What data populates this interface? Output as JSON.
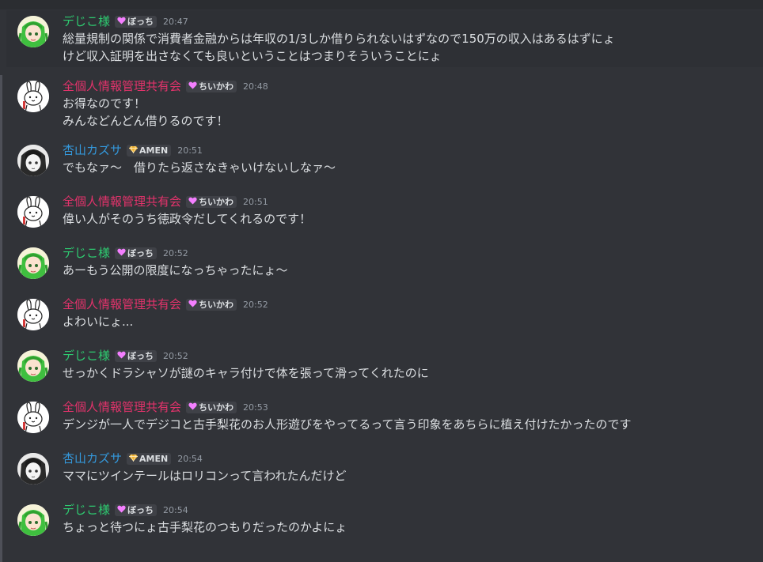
{
  "colors": {
    "background": "#313338",
    "name_dejiko": "#2ecc71",
    "name_zenko": "#e2336b",
    "name_kazusa": "#3498db",
    "timestamp": "#949ba4",
    "role_badge_bg": "#3f4147",
    "heart_icon": "#f47fff",
    "gem_icon": "#f0b232"
  },
  "messages": [
    {
      "author": "デじこ様",
      "author_class": "dejiko",
      "role_icon": "heart-icon",
      "role": "ぼっち",
      "time": "20:47",
      "lines": [
        "総量規制の関係で消費者金融からは年収の1/3しか借りられないはずなので150万の収入はあるはずにょ",
        "けど収入証明を出さなくても良いということはつまりそういうことにょ"
      ]
    },
    {
      "author": "全個人情報管理共有会",
      "author_class": "zenko",
      "role_icon": "heart-icon",
      "role": "ちいかわ",
      "time": "20:48",
      "lines": [
        "お得なのです！",
        "みんなどんどん借りるのです！"
      ]
    },
    {
      "author": "杏山カズサ",
      "author_class": "kazusa",
      "role_icon": "gem-icon",
      "role": "AMEN",
      "time": "20:51",
      "lines": [
        "でもなァ～　借りたら返さなきゃいけないしなァ～"
      ]
    },
    {
      "author": "全個人情報管理共有会",
      "author_class": "zenko",
      "role_icon": "heart-icon",
      "role": "ちいかわ",
      "time": "20:51",
      "lines": [
        "偉い人がそのうち徳政令だしてくれるのです！"
      ]
    },
    {
      "author": "デじこ様",
      "author_class": "dejiko",
      "role_icon": "heart-icon",
      "role": "ぼっち",
      "time": "20:52",
      "lines": [
        "あーもう公開の限度になっちゃったにょ～"
      ]
    },
    {
      "author": "全個人情報管理共有会",
      "author_class": "zenko",
      "role_icon": "heart-icon",
      "role": "ちいかわ",
      "time": "20:52",
      "lines": [
        "よわいにょ..."
      ]
    },
    {
      "author": "デじこ様",
      "author_class": "dejiko",
      "role_icon": "heart-icon",
      "role": "ぼっち",
      "time": "20:52",
      "lines": [
        "せっかくドラシャソが謎のキャラ付けで体を張って滑ってくれたのに"
      ]
    },
    {
      "author": "全個人情報管理共有会",
      "author_class": "zenko",
      "role_icon": "heart-icon",
      "role": "ちいかわ",
      "time": "20:53",
      "lines": [
        "デンジが一人でデジコと古手梨花のお人形遊びをやってるって言う印象をあちらに植え付けたかったのです"
      ]
    },
    {
      "author": "杏山カズサ",
      "author_class": "kazusa",
      "role_icon": "gem-icon",
      "role": "AMEN",
      "time": "20:54",
      "lines": [
        "ママにツインテールはロリコンって言われたんだけど"
      ]
    },
    {
      "author": "デじこ様",
      "author_class": "dejiko",
      "role_icon": "heart-icon",
      "role": "ぼっち",
      "time": "20:54",
      "lines": [
        "ちょっと待つにょ古手梨花のつもりだったのかよにょ"
      ]
    }
  ]
}
